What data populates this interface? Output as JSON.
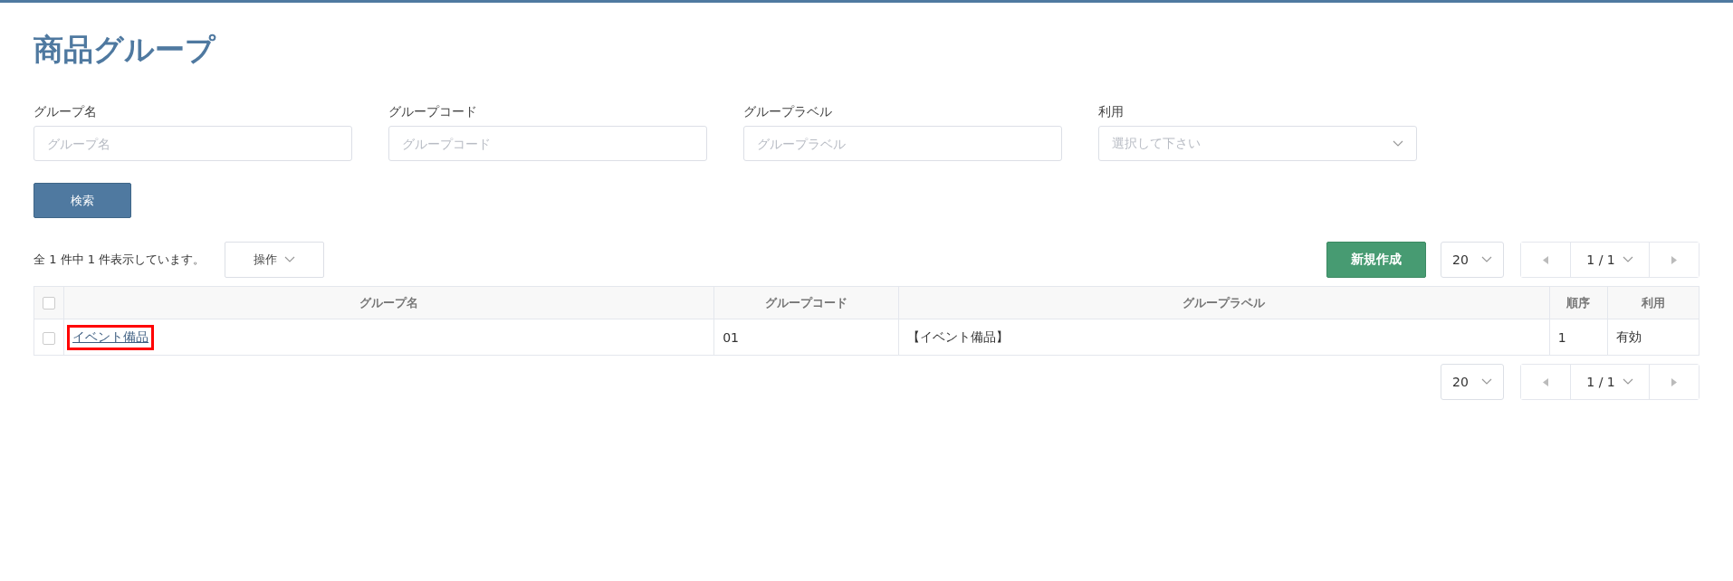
{
  "page": {
    "title": "商品グループ"
  },
  "filters": [
    {
      "kind": "text",
      "label": "グループ名",
      "placeholder": "グループ名"
    },
    {
      "kind": "text",
      "label": "グループコード",
      "placeholder": "グループコード"
    },
    {
      "kind": "text",
      "label": "グループラベル",
      "placeholder": "グループラベル"
    },
    {
      "kind": "select",
      "label": "利用",
      "placeholder": "選択して下さい"
    }
  ],
  "search_button": "検索",
  "toolbar": {
    "count": "全 1 件中 1 件表示しています。",
    "actions_button": "操作",
    "create_button": "新規作成"
  },
  "pagination_top": {
    "page_size": "20",
    "page": "1 / 1"
  },
  "table": {
    "columns": [
      {
        "label": "グループ名"
      },
      {
        "label": "グループコード"
      },
      {
        "label": "グループラベル"
      },
      {
        "label": "順序"
      },
      {
        "label": "利用"
      }
    ],
    "all_checked": false,
    "rows": [
      {
        "checked": false,
        "highlighted": true,
        "name": "イベント備品",
        "code": "01",
        "label": "【イベント備品】",
        "order": "1",
        "status": "有効"
      }
    ]
  },
  "pagination_bottom": {
    "page_size": "20",
    "page": "1 / 1"
  }
}
